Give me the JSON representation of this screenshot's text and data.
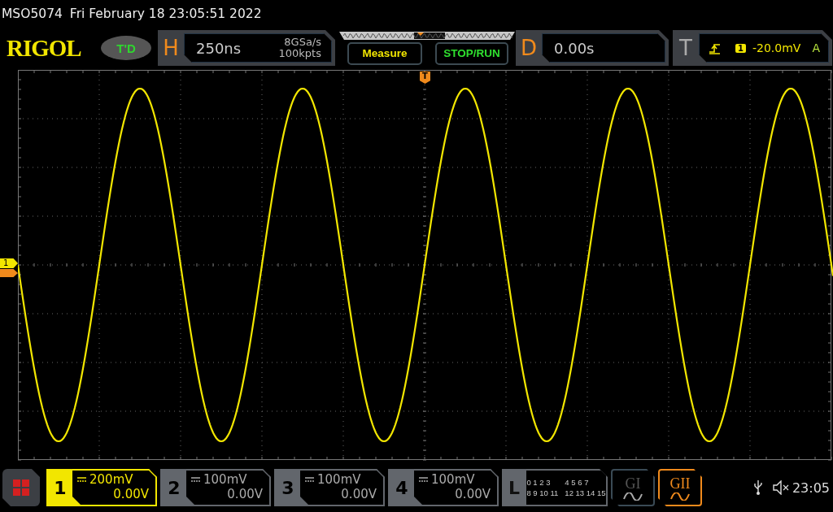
{
  "status_line": {
    "model": "MSO5074",
    "datetime": "Fri February 18 23:05:51 2022"
  },
  "toolbar": {
    "logo": "RIGOL",
    "td_button": "T'D",
    "horizontal": {
      "label": "H",
      "timebase": "250ns",
      "sample_rate": "8GSa/s",
      "memory_depth": "100kpts"
    },
    "measure_button": "Measure",
    "stop_run_button": "STOP/RUN",
    "delay": {
      "label": "D",
      "value": "0.00s"
    },
    "trigger": {
      "label": "T",
      "source": "1",
      "level": "-20.0mV",
      "mode": "A"
    }
  },
  "screen": {
    "trigger_position_marker": "T",
    "channel_marker": "1"
  },
  "channels": [
    {
      "number": "1",
      "scale": "200mV",
      "offset": "0.00V",
      "on": true
    },
    {
      "number": "2",
      "scale": "100mV",
      "offset": "0.00V",
      "on": false
    },
    {
      "number": "3",
      "scale": "100mV",
      "offset": "0.00V",
      "on": false
    },
    {
      "number": "4",
      "scale": "100mV",
      "offset": "0.00V",
      "on": false
    }
  ],
  "logic": {
    "label": "L",
    "groups": [
      "0 1 2 3",
      "4 5 6 7",
      "8 9 10 11",
      "12 13 14 15"
    ]
  },
  "generators": [
    {
      "label": "GI",
      "on": false
    },
    {
      "label": "GII",
      "on": true
    }
  ],
  "clock": "23:05"
}
